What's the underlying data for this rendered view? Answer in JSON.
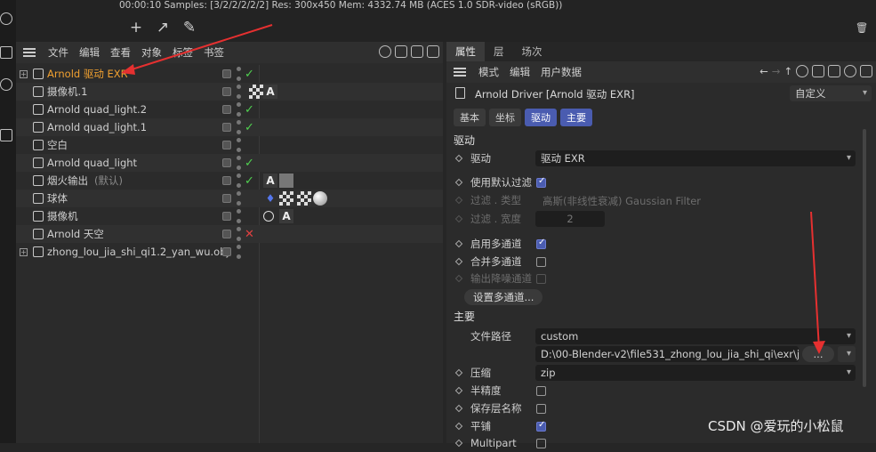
{
  "statusbar": {
    "text": "00:00:10  Samples: [3/2/2/2/2/2]  Res: 300x450  Mem: 4332.74 MB  (ACES 1.0 SDR-video (sRGB))"
  },
  "object_manager": {
    "menu": [
      "文件",
      "编辑",
      "查看",
      "对象",
      "标签",
      "书签"
    ],
    "rows": [
      {
        "name": "Arnold 驱动 EXR",
        "selected": true,
        "status": "check",
        "expand": "+"
      },
      {
        "name": "摄像机.1",
        "selected": false,
        "status": "none",
        "tags": [
          "A"
        ]
      },
      {
        "name": "Arnold quad_light.2",
        "selected": false,
        "status": "check"
      },
      {
        "name": "Arnold quad_light.1",
        "selected": false,
        "status": "check"
      },
      {
        "name": "空白",
        "selected": false,
        "status": "none"
      },
      {
        "name": "Arnold quad_light",
        "selected": false,
        "status": "check"
      },
      {
        "name": "烟火输出",
        "suffix": "(默认)",
        "selected": false,
        "status": "check",
        "tags": [
          "A"
        ]
      },
      {
        "name": "球体",
        "selected": false,
        "status": "none"
      },
      {
        "name": "摄像机",
        "selected": false,
        "status": "none",
        "tags": [
          "A"
        ]
      },
      {
        "name": "Arnold 天空",
        "selected": false,
        "status": "x"
      },
      {
        "name": "zhong_lou_jia_shi_qi1.2_yan_wu.obj",
        "selected": false,
        "status": "none",
        "expand": "+"
      }
    ]
  },
  "attributes": {
    "tabs": [
      "属性",
      "层",
      "场次"
    ],
    "menu": [
      "模式",
      "编辑",
      "用户数据"
    ],
    "title": "Arnold Driver [Arnold 驱动 EXR]",
    "preset": "自定义",
    "subtabs": [
      "基本",
      "坐标",
      "驱动",
      "主要"
    ],
    "section_driver": "驱动",
    "driver_label": "驱动",
    "driver_value": "驱动 EXR",
    "use_default_filter_label": "使用默认过滤",
    "filter_type_label": "过滤 . 类型",
    "filter_type_value": "高斯(非线性衰减) Gaussian Filter",
    "filter_width_label": "过滤 . 宽度",
    "filter_width_value": "2",
    "multipass_label": "启用多通道",
    "merge_multipass_label": "合并多通道",
    "denoise_label": "输出降噪通道",
    "setup_multipass_button": "设置多通道...",
    "section_main": "主要",
    "filepath_label": "文件路径",
    "filepath_mode": "custom",
    "filepath_value": "D:\\00-Blender-v2\\file531_zhong_lou_jia_shi_qi\\exr\\jian",
    "browse_button": "...",
    "compression_label": "压缩",
    "compression_value": "zip",
    "half_precision_label": "半精度",
    "save_layer_names_label": "保存层名称",
    "tiled_label": "平铺",
    "multipart_label": "Multipart"
  },
  "watermark": "CSDN @爱玩的小松鼠"
}
